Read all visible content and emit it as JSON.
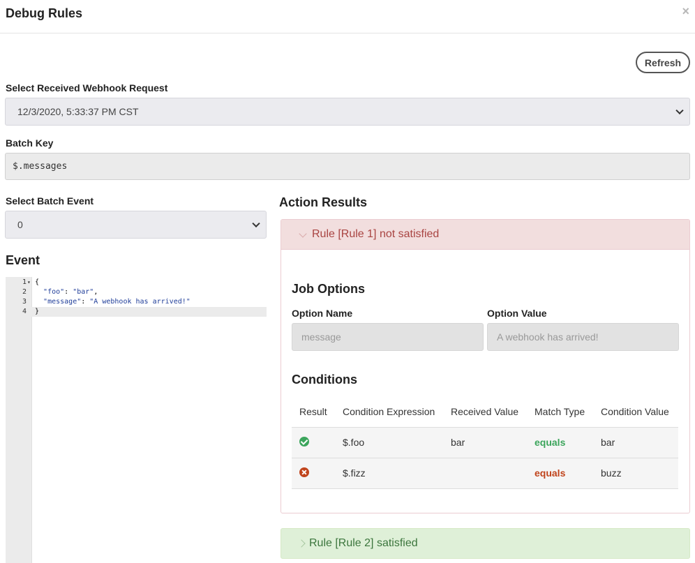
{
  "header": {
    "title": "Debug Rules",
    "close_glyph": "×"
  },
  "toolbar": {
    "refresh_label": "Refresh"
  },
  "webhook_request": {
    "label": "Select Received Webhook Request",
    "selected": "12/3/2020, 5:33:37 PM CST"
  },
  "batch_key": {
    "label": "Batch Key",
    "value": "$.messages"
  },
  "batch_event": {
    "label": "Select Batch Event",
    "selected": "0"
  },
  "event": {
    "title": "Event",
    "lines": [
      {
        "num": "1",
        "text": "{",
        "fold": "▾"
      },
      {
        "num": "2",
        "key": "\"foo\"",
        "value": "\"bar\"",
        "trail": ","
      },
      {
        "num": "3",
        "key": "\"message\"",
        "value": "\"A webhook has arrived!\"",
        "trail": ""
      },
      {
        "num": "4",
        "text": "}"
      }
    ]
  },
  "action_results": {
    "title": "Action Results",
    "rules": [
      {
        "header": "Rule [Rule 1] not satisfied",
        "status": "not satisfied",
        "job_options": {
          "title": "Job Options",
          "col_name": "Option Name",
          "col_value": "Option Value",
          "name": "message",
          "value": "A webhook has arrived!"
        },
        "conditions": {
          "title": "Conditions",
          "headers": [
            "Result",
            "Condition Expression",
            "Received Value",
            "Match Type",
            "Condition Value"
          ],
          "rows": [
            {
              "result_icon": "check-circle-icon",
              "expression": "$.foo",
              "received": "bar",
              "match": "equals",
              "condition_value": "bar"
            },
            {
              "result_icon": "times-circle-icon",
              "expression": "$.fizz",
              "received": "",
              "match": "equals",
              "condition_value": "buzz"
            }
          ]
        }
      },
      {
        "header": "Rule [Rule 2] satisfied",
        "status": "satisfied"
      }
    ]
  },
  "colors": {
    "danger_bg": "#f2dede",
    "danger_text": "#a94442",
    "success_bg": "#dff0d8",
    "success_text": "#3c763d",
    "match_ok": "#3ca55c",
    "match_bad": "#c0441c"
  }
}
